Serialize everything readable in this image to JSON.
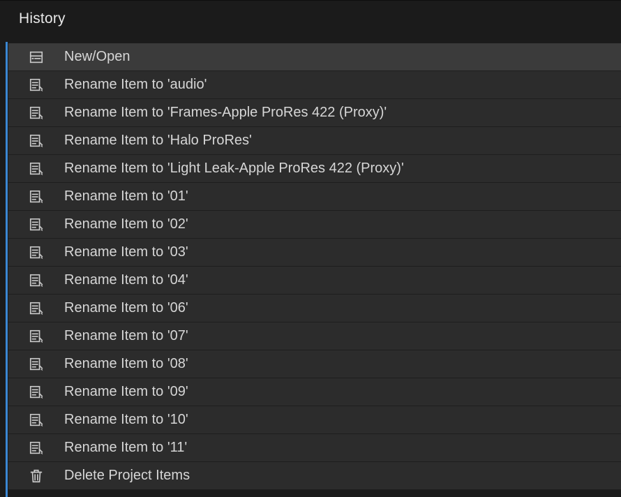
{
  "panel": {
    "title": "History"
  },
  "history": {
    "items": [
      {
        "icon": "new-open-icon",
        "label": "New/Open",
        "selected": true
      },
      {
        "icon": "rename-icon",
        "label": "Rename Item to 'audio'"
      },
      {
        "icon": "rename-icon",
        "label": "Rename Item to 'Frames-Apple ProRes 422 (Proxy)'"
      },
      {
        "icon": "rename-icon",
        "label": "Rename Item to 'Halo ProRes'"
      },
      {
        "icon": "rename-icon",
        "label": "Rename Item to 'Light Leak-Apple ProRes 422 (Proxy)'"
      },
      {
        "icon": "rename-icon",
        "label": "Rename Item to '01'"
      },
      {
        "icon": "rename-icon",
        "label": "Rename Item to '02'"
      },
      {
        "icon": "rename-icon",
        "label": "Rename Item to '03'"
      },
      {
        "icon": "rename-icon",
        "label": "Rename Item to '04'"
      },
      {
        "icon": "rename-icon",
        "label": "Rename Item to '06'"
      },
      {
        "icon": "rename-icon",
        "label": "Rename Item to '07'"
      },
      {
        "icon": "rename-icon",
        "label": "Rename Item to '08'"
      },
      {
        "icon": "rename-icon",
        "label": "Rename Item to '09'"
      },
      {
        "icon": "rename-icon",
        "label": "Rename Item to '10'"
      },
      {
        "icon": "rename-icon",
        "label": "Rename Item to '11'"
      },
      {
        "icon": "trash-icon",
        "label": "Delete Project Items"
      }
    ]
  }
}
